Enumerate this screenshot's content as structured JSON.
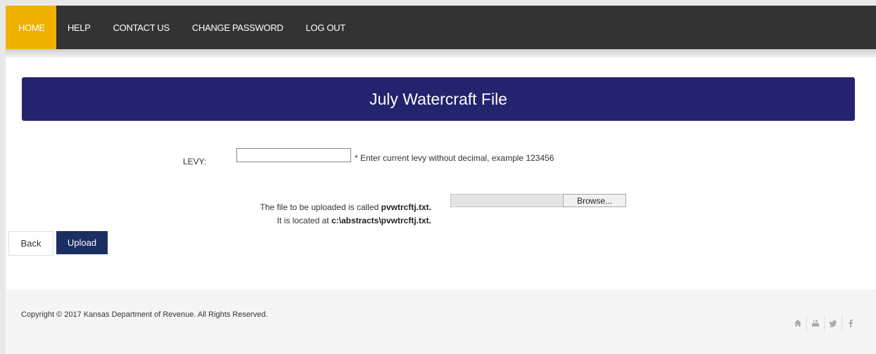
{
  "nav": {
    "items": [
      {
        "label": "HOME",
        "active": true
      },
      {
        "label": "HELP",
        "active": false
      },
      {
        "label": "CONTACT US",
        "active": false
      },
      {
        "label": "CHANGE PASSWORD",
        "active": false
      },
      {
        "label": "LOG OUT",
        "active": false
      }
    ],
    "active_color": "#f0b000",
    "bar_color": "#333333"
  },
  "title": "July Watercraft File",
  "form": {
    "levy_label": "LEVY:",
    "levy_value": "",
    "levy_hint": "* Enter current levy without decimal, example 123456",
    "file_line1_prefix": "The file to be uploaded is called ",
    "file_name": "pvwtrcftj.txt.",
    "file_line2_prefix": "It is located at ",
    "file_path": "c:\\abstracts\\pvwtrcftj.txt.",
    "browse_label": "Browse..."
  },
  "buttons": {
    "back": "Back",
    "upload": "Upload"
  },
  "footer": {
    "copyright": "Copyright © 2017 Kansas Department of Revenue. All Rights Reserved.",
    "social_icons": [
      "home-icon",
      "youtube-icon",
      "twitter-icon",
      "facebook-icon"
    ]
  },
  "colors": {
    "title_bar": "#23236e",
    "upload_button": "#1b2f63"
  }
}
